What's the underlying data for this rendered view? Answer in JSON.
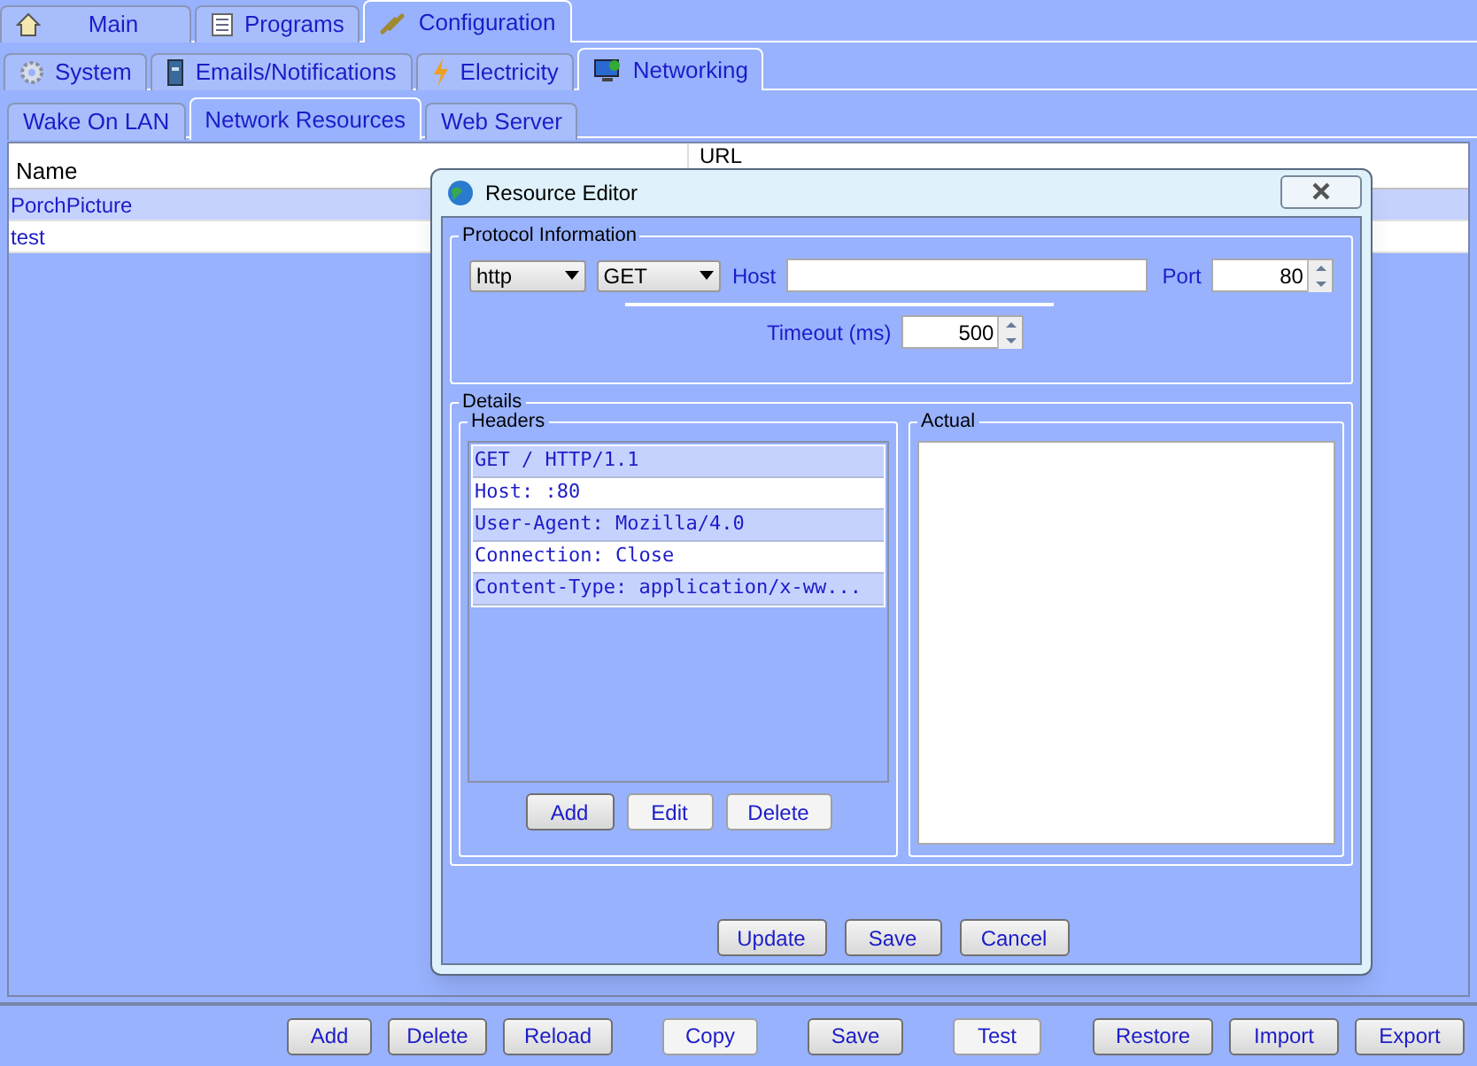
{
  "main_tabs": [
    {
      "label": "Main",
      "selected": false
    },
    {
      "label": "Programs",
      "selected": false
    },
    {
      "label": "Configuration",
      "selected": true
    }
  ],
  "config_tabs": [
    {
      "label": "System",
      "selected": false
    },
    {
      "label": "Emails/Notifications",
      "selected": false
    },
    {
      "label": "Electricity",
      "selected": false
    },
    {
      "label": "Networking",
      "selected": true
    }
  ],
  "network_tabs": [
    {
      "label": "Wake On LAN",
      "selected": false
    },
    {
      "label": "Network Resources",
      "selected": true
    },
    {
      "label": "Web Server",
      "selected": false
    }
  ],
  "table": {
    "columns": [
      "Name",
      "URL"
    ],
    "rows": [
      {
        "name": "PorchPicture",
        "selected": true
      },
      {
        "name": "test",
        "selected": false
      }
    ]
  },
  "toolbar": [
    "Add",
    "Delete",
    "Reload",
    "Copy",
    "Save",
    "Test",
    "Restore",
    "Import",
    "Export"
  ],
  "dialog": {
    "title": "Resource Editor",
    "protocol": {
      "legend": "Protocol Information",
      "scheme": "http",
      "method": "GET",
      "host_label": "Host",
      "port_label": "Port",
      "port": "80",
      "timeout_label": "Timeout (ms)",
      "timeout": "500"
    },
    "details": {
      "legend": "Details",
      "headers_legend": "Headers",
      "actual_legend": "Actual",
      "headers": [
        {
          "text": "GET / HTTP/1.1",
          "selected": true
        },
        {
          "text": "Host: :80",
          "selected": false
        },
        {
          "text": "User-Agent: Mozilla/4.0",
          "selected": true
        },
        {
          "text": "Connection: Close",
          "selected": false
        },
        {
          "text": "Content-Type: application/x-ww...",
          "selected": true
        }
      ],
      "header_buttons": [
        "Add",
        "Edit",
        "Delete"
      ]
    },
    "buttons": [
      "Update",
      "Save",
      "Cancel"
    ]
  }
}
